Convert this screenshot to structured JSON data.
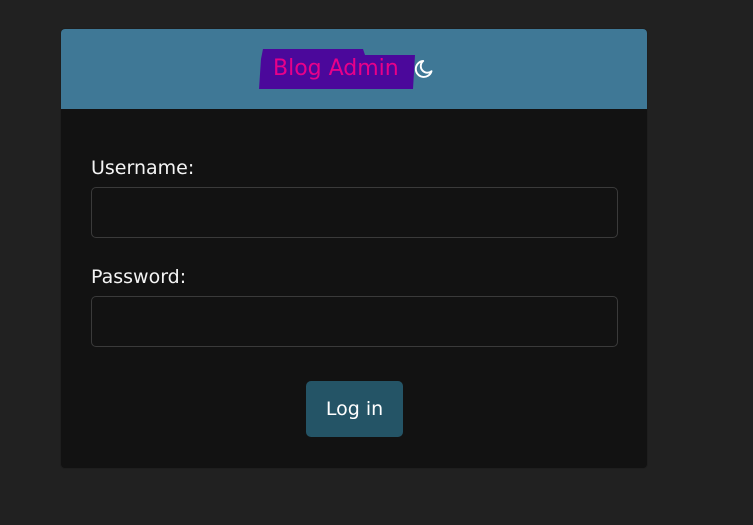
{
  "header": {
    "title": "Blog Admin",
    "theme_toggle_icon": "crescent-moon-icon",
    "background_color": "#3f7896",
    "title_color": "#e8008a",
    "highlight_color": "#4b089b"
  },
  "form": {
    "username_label": "Username:",
    "username_value": "",
    "password_label": "Password:",
    "password_value": "",
    "submit_label": "Log in",
    "submit_color": "#245466"
  },
  "page": {
    "background_color": "#212121",
    "card_color": "#121212"
  }
}
